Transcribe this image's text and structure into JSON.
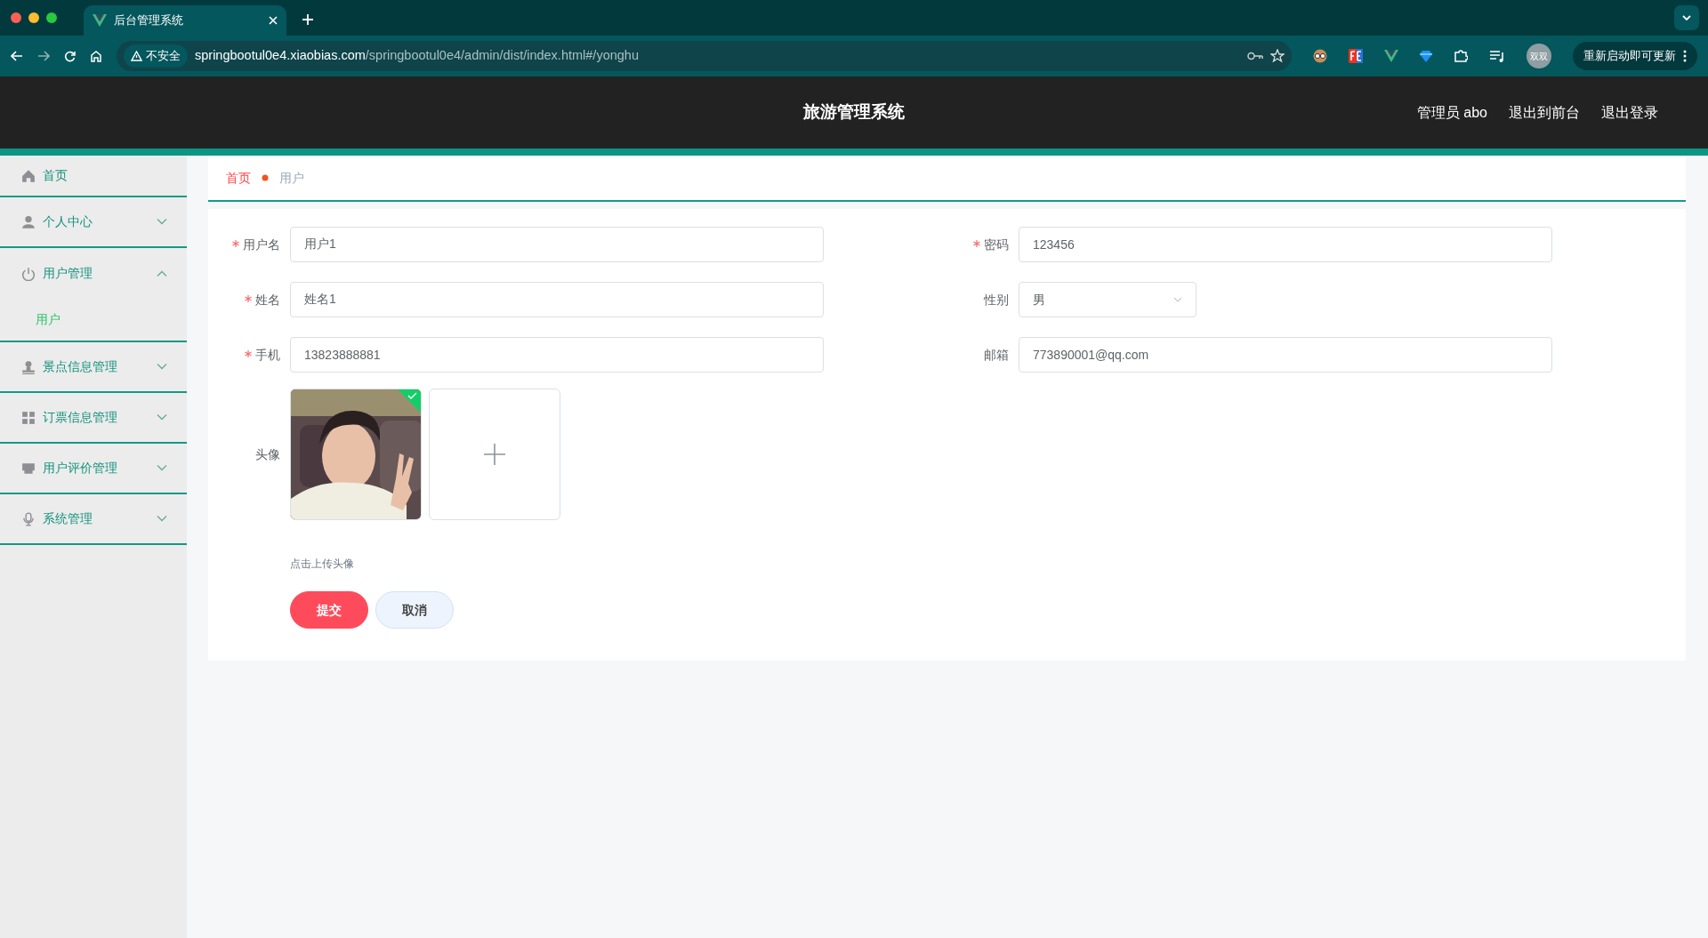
{
  "browser": {
    "tabs": [
      {
        "title": "后台管理系统",
        "selected": true
      }
    ],
    "security_label": "不安全",
    "url": {
      "host": "springbootul0e4.xiaobias.com",
      "path": "/springbootul0e4/admin/dist/index.html#/yonghu"
    },
    "profile_badge": "双双",
    "update_button": "重新启动即可更新"
  },
  "header": {
    "title": "旅游管理系统",
    "links": [
      "管理员 abo",
      "退出到前台",
      "退出登录"
    ]
  },
  "sidebar": {
    "items": [
      {
        "label": "首页",
        "kind": "link"
      },
      {
        "label": "个人中心",
        "kind": "submenu",
        "expanded": false
      },
      {
        "label": "用户管理",
        "kind": "submenu",
        "expanded": true,
        "children": [
          {
            "label": "用户",
            "selected": true
          }
        ]
      },
      {
        "label": "景点信息管理",
        "kind": "submenu",
        "expanded": false
      },
      {
        "label": "订票信息管理",
        "kind": "submenu",
        "expanded": false
      },
      {
        "label": "用户评价管理",
        "kind": "submenu",
        "expanded": false
      },
      {
        "label": "系统管理",
        "kind": "submenu",
        "expanded": false
      }
    ]
  },
  "breadcrumb": [
    {
      "label": "首页",
      "selected": false
    },
    {
      "label": "用户",
      "selected": true
    }
  ],
  "form": {
    "fields": [
      {
        "label": "用户名",
        "required": true,
        "kind": "text",
        "value": "用户1"
      },
      {
        "label": "密码",
        "required": true,
        "kind": "text",
        "value": "123456"
      },
      {
        "label": "姓名",
        "required": true,
        "kind": "text",
        "value": "姓名1"
      },
      {
        "label": "性别",
        "required": false,
        "kind": "select",
        "value": "男"
      },
      {
        "label": "手机",
        "required": true,
        "kind": "text",
        "value": "13823888881"
      },
      {
        "label": "邮箱",
        "required": false,
        "kind": "text",
        "value": "773890001@qq.com"
      }
    ],
    "avatar": {
      "label": "头像",
      "required": false,
      "uploaded": true,
      "hint": "点击上传头像"
    },
    "buttons": [
      {
        "label": "提交",
        "kind": "primary"
      },
      {
        "label": "取消",
        "kind": "secondary"
      }
    ]
  }
}
